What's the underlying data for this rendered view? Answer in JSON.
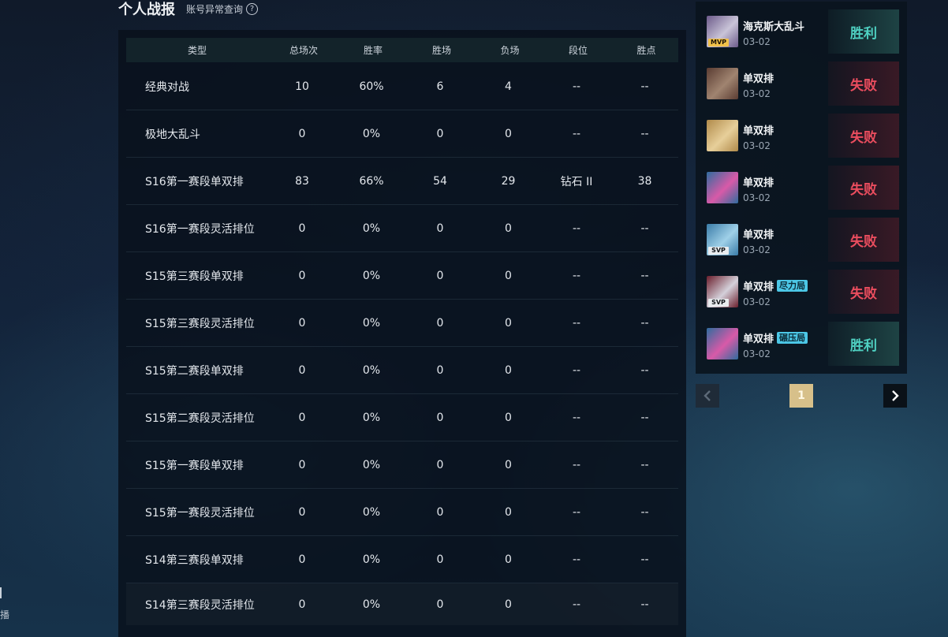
{
  "header": {
    "title": "个人战报",
    "link": "账号异常查询",
    "help_icon": "?"
  },
  "table": {
    "columns": [
      "类型",
      "总场次",
      "胜率",
      "胜场",
      "负场",
      "段位",
      "胜点"
    ],
    "rows": [
      [
        "经典对战",
        "10",
        "60%",
        "6",
        "4",
        "--",
        "--"
      ],
      [
        "极地大乱斗",
        "0",
        "0%",
        "0",
        "0",
        "--",
        "--"
      ],
      [
        "S16第一赛段单双排",
        "83",
        "66%",
        "54",
        "29",
        "钻石 II",
        "38"
      ],
      [
        "S16第一赛段灵活排位",
        "0",
        "0%",
        "0",
        "0",
        "--",
        "--"
      ],
      [
        "S15第三赛段单双排",
        "0",
        "0%",
        "0",
        "0",
        "--",
        "--"
      ],
      [
        "S15第三赛段灵活排位",
        "0",
        "0%",
        "0",
        "0",
        "--",
        "--"
      ],
      [
        "S15第二赛段单双排",
        "0",
        "0%",
        "0",
        "0",
        "--",
        "--"
      ],
      [
        "S15第二赛段灵活排位",
        "0",
        "0%",
        "0",
        "0",
        "--",
        "--"
      ],
      [
        "S15第一赛段单双排",
        "0",
        "0%",
        "0",
        "0",
        "--",
        "--"
      ],
      [
        "S15第一赛段灵活排位",
        "0",
        "0%",
        "0",
        "0",
        "--",
        "--"
      ],
      [
        "S14第三赛段单双排",
        "0",
        "0%",
        "0",
        "0",
        "--",
        "--"
      ],
      [
        "S14第三赛段灵活排位",
        "0",
        "0%",
        "0",
        "0",
        "--",
        "--"
      ]
    ]
  },
  "matches": [
    {
      "mode": "海克斯大乱斗",
      "date": "03-02",
      "result": "胜利",
      "outcome": "win",
      "badge": "MVP",
      "tag": "",
      "avatar": [
        "#6c5a8a",
        "#c9c4d8"
      ]
    },
    {
      "mode": "单双排",
      "date": "03-02",
      "result": "失败",
      "outcome": "lose",
      "badge": "",
      "tag": "",
      "avatar": [
        "#5a3c32",
        "#a08470"
      ]
    },
    {
      "mode": "单双排",
      "date": "03-02",
      "result": "失败",
      "outcome": "lose",
      "badge": "",
      "tag": "",
      "avatar": [
        "#b08a4a",
        "#e7cf9a"
      ]
    },
    {
      "mode": "单双排",
      "date": "03-02",
      "result": "失败",
      "outcome": "lose",
      "badge": "",
      "tag": "",
      "avatar": [
        "#2f6c9e",
        "#d85aa8"
      ]
    },
    {
      "mode": "单双排",
      "date": "03-02",
      "result": "失败",
      "outcome": "lose",
      "badge": "SVP",
      "tag": "",
      "avatar": [
        "#3a7ca8",
        "#9fd0e8"
      ]
    },
    {
      "mode": "单双排",
      "date": "03-02",
      "result": "失败",
      "outcome": "lose",
      "badge": "SVP",
      "tag": "尽力局",
      "avatar": [
        "#6a1e2c",
        "#d4d0da"
      ]
    },
    {
      "mode": "单双排",
      "date": "03-02",
      "result": "胜利",
      "outcome": "win",
      "badge": "",
      "tag": "碾压局",
      "avatar": [
        "#2f6c9e",
        "#d85aa8"
      ]
    }
  ],
  "pagination": {
    "current": "1",
    "prev_icon": "chevron-left",
    "next_icon": "chevron-right"
  },
  "edge": {
    "bottom_char": "播"
  },
  "colors": {
    "win": "#4fd1c2",
    "lose": "#ea4d5e",
    "page_active": "#d7c08a",
    "tag": "#4cc7e6"
  }
}
